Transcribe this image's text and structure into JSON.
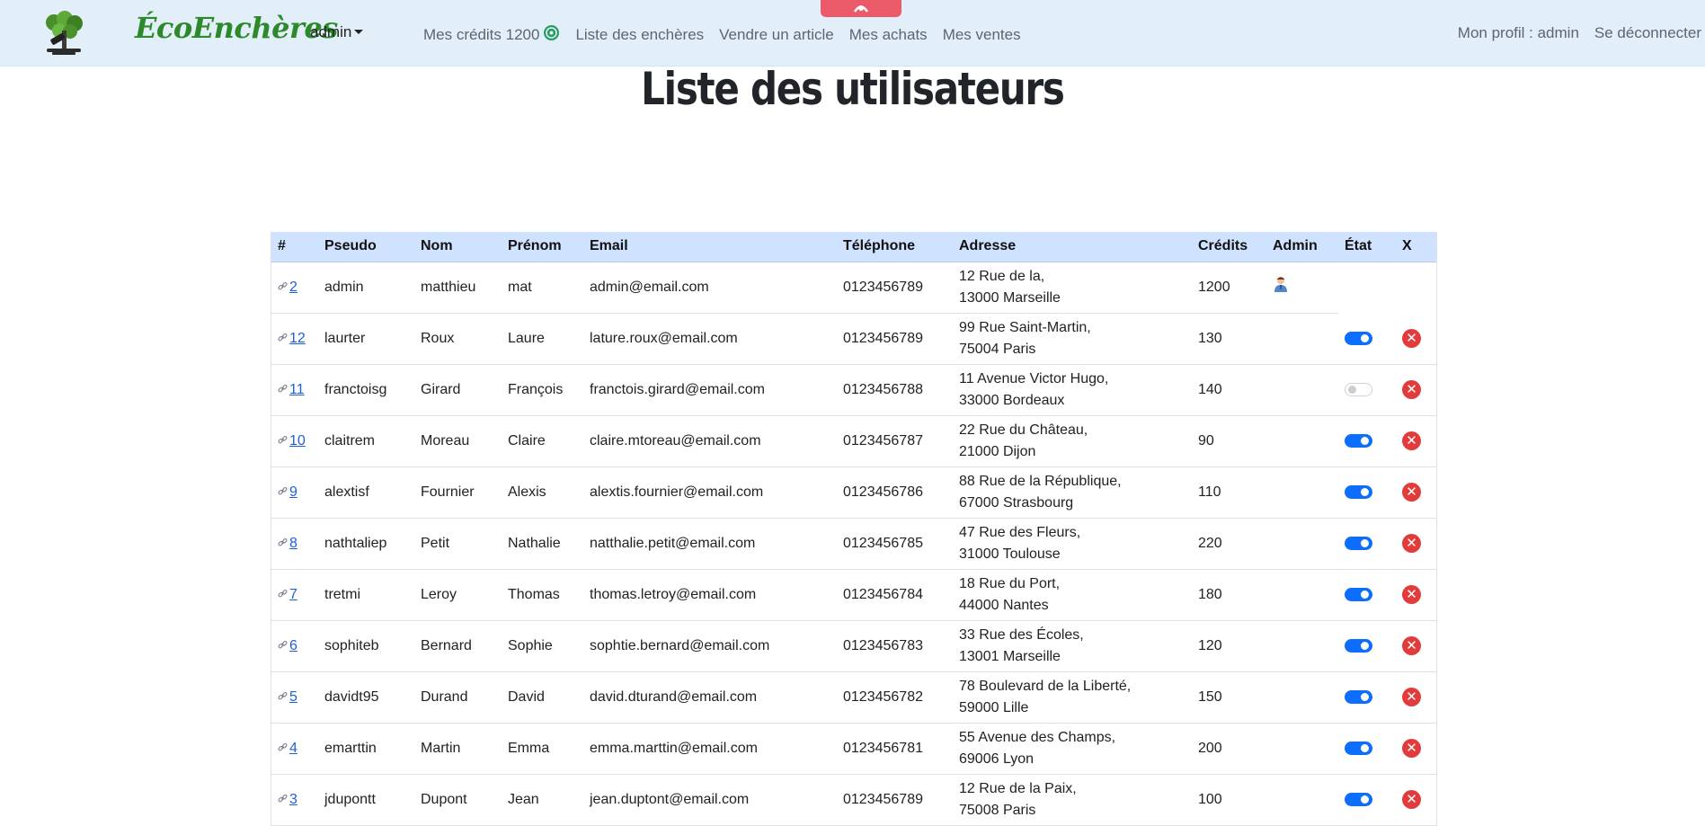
{
  "nav": {
    "brand": "ÉcoEnchères",
    "user_menu": "admin",
    "credits_label": "Mes crédits 1200",
    "links": [
      "Liste des enchères",
      "Vendre un article",
      "Mes achats",
      "Mes ventes"
    ],
    "profile": "Mon profil : admin",
    "logout": "Se déconnecter"
  },
  "page_title": "Liste des utilisateurs",
  "table": {
    "headers": [
      "#",
      "Pseudo",
      "Nom",
      "Prénom",
      "Email",
      "Téléphone",
      "Adresse",
      "Crédits",
      "Admin",
      "État",
      "X"
    ],
    "rows": [
      {
        "id": "2",
        "pseudo": "admin",
        "nom": "matthieu",
        "prenom": "mat",
        "email": "admin@email.com",
        "tel": "0123456789",
        "addr1": "12 Rue de la,",
        "addr2": "13000 Marseille",
        "credits": "1200",
        "admin": true,
        "active": null
      },
      {
        "id": "12",
        "pseudo": "laurter",
        "nom": "Roux",
        "prenom": "Laure",
        "email": "lature.roux@email.com",
        "tel": "0123456789",
        "addr1": "99 Rue Saint-Martin,",
        "addr2": "75004 Paris",
        "credits": "130",
        "admin": false,
        "active": true
      },
      {
        "id": "11",
        "pseudo": "franctoisg",
        "nom": "Girard",
        "prenom": "François",
        "email": "franctois.girard@email.com",
        "tel": "0123456788",
        "addr1": "11 Avenue Victor Hugo,",
        "addr2": "33000 Bordeaux",
        "credits": "140",
        "admin": false,
        "active": false
      },
      {
        "id": "10",
        "pseudo": "claitrem",
        "nom": "Moreau",
        "prenom": "Claire",
        "email": "claire.mtoreau@email.com",
        "tel": "0123456787",
        "addr1": "22 Rue du Château,",
        "addr2": "21000 Dijon",
        "credits": "90",
        "admin": false,
        "active": true
      },
      {
        "id": "9",
        "pseudo": "alextisf",
        "nom": "Fournier",
        "prenom": "Alexis",
        "email": "alextis.fournier@email.com",
        "tel": "0123456786",
        "addr1": "88 Rue de la République,",
        "addr2": "67000 Strasbourg",
        "credits": "110",
        "admin": false,
        "active": true
      },
      {
        "id": "8",
        "pseudo": "nathtaliep",
        "nom": "Petit",
        "prenom": "Nathalie",
        "email": "natthalie.petit@email.com",
        "tel": "0123456785",
        "addr1": "47 Rue des Fleurs,",
        "addr2": "31000 Toulouse",
        "credits": "220",
        "admin": false,
        "active": true
      },
      {
        "id": "7",
        "pseudo": "tretmi",
        "nom": "Leroy",
        "prenom": "Thomas",
        "email": "thomas.letroy@email.com",
        "tel": "0123456784",
        "addr1": "18 Rue du Port,",
        "addr2": "44000 Nantes",
        "credits": "180",
        "admin": false,
        "active": true
      },
      {
        "id": "6",
        "pseudo": "sophiteb",
        "nom": "Bernard",
        "prenom": "Sophie",
        "email": "sophtie.bernard@email.com",
        "tel": "0123456783",
        "addr1": "33 Rue des Écoles,",
        "addr2": "13001 Marseille",
        "credits": "120",
        "admin": false,
        "active": true
      },
      {
        "id": "5",
        "pseudo": "davidt95",
        "nom": "Durand",
        "prenom": "David",
        "email": "david.dturand@email.com",
        "tel": "0123456782",
        "addr1": "78 Boulevard de la Liberté,",
        "addr2": "59000 Lille",
        "credits": "150",
        "admin": false,
        "active": true
      },
      {
        "id": "4",
        "pseudo": "emarttin",
        "nom": "Martin",
        "prenom": "Emma",
        "email": "emma.marttin@email.com",
        "tel": "0123456781",
        "addr1": "55 Avenue des Champs,",
        "addr2": "69006 Lyon",
        "credits": "200",
        "admin": false,
        "active": true
      },
      {
        "id": "3",
        "pseudo": "jdupontt",
        "nom": "Dupont",
        "prenom": "Jean",
        "email": "jean.duptont@email.com",
        "tel": "0123456789",
        "addr1": "12 Rue de la Paix,",
        "addr2": "75008 Paris",
        "credits": "100",
        "admin": false,
        "active": true
      }
    ]
  },
  "icons": {
    "logo": "tree-gavel-logo-icon",
    "credits": "coin-icon",
    "id_link": "link-icon",
    "admin": "admin-user-icon",
    "delete": "delete-x-icon",
    "scroll": "scroll-top-icon"
  },
  "colors": {
    "navbar_bg": "#e2eef8",
    "brand": "#2c8a2a",
    "table_header_bg": "#cfe2ff",
    "toggle_on": "#0d6efd",
    "delete": "#e23b3b",
    "scroll_tab": "#ea5a68",
    "link": "#1e5fd8"
  }
}
